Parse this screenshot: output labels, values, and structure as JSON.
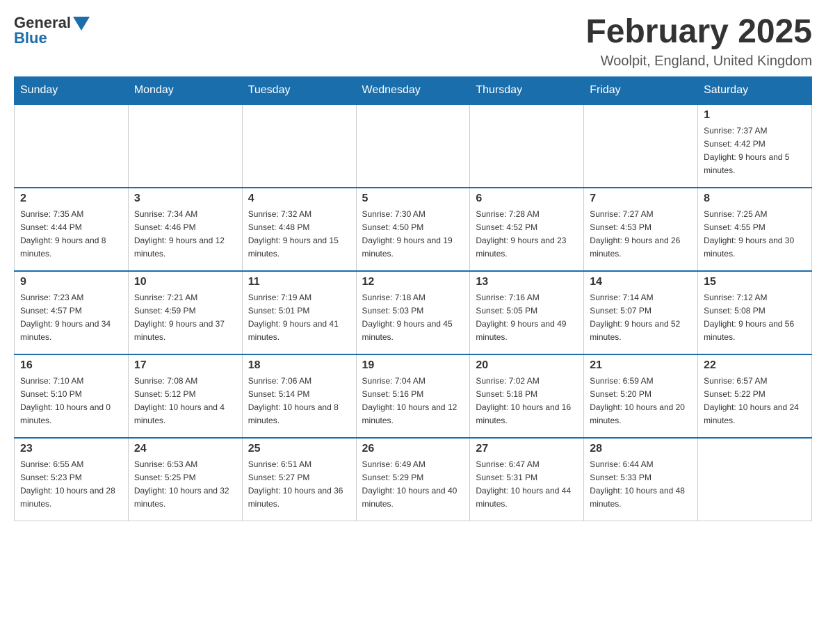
{
  "header": {
    "logo_general": "General",
    "logo_blue": "Blue",
    "month_title": "February 2025",
    "location": "Woolpit, England, United Kingdom"
  },
  "days_of_week": [
    "Sunday",
    "Monday",
    "Tuesday",
    "Wednesday",
    "Thursday",
    "Friday",
    "Saturday"
  ],
  "weeks": [
    [
      {
        "day": "",
        "info": ""
      },
      {
        "day": "",
        "info": ""
      },
      {
        "day": "",
        "info": ""
      },
      {
        "day": "",
        "info": ""
      },
      {
        "day": "",
        "info": ""
      },
      {
        "day": "",
        "info": ""
      },
      {
        "day": "1",
        "info": "Sunrise: 7:37 AM\nSunset: 4:42 PM\nDaylight: 9 hours and 5 minutes."
      }
    ],
    [
      {
        "day": "2",
        "info": "Sunrise: 7:35 AM\nSunset: 4:44 PM\nDaylight: 9 hours and 8 minutes."
      },
      {
        "day": "3",
        "info": "Sunrise: 7:34 AM\nSunset: 4:46 PM\nDaylight: 9 hours and 12 minutes."
      },
      {
        "day": "4",
        "info": "Sunrise: 7:32 AM\nSunset: 4:48 PM\nDaylight: 9 hours and 15 minutes."
      },
      {
        "day": "5",
        "info": "Sunrise: 7:30 AM\nSunset: 4:50 PM\nDaylight: 9 hours and 19 minutes."
      },
      {
        "day": "6",
        "info": "Sunrise: 7:28 AM\nSunset: 4:52 PM\nDaylight: 9 hours and 23 minutes."
      },
      {
        "day": "7",
        "info": "Sunrise: 7:27 AM\nSunset: 4:53 PM\nDaylight: 9 hours and 26 minutes."
      },
      {
        "day": "8",
        "info": "Sunrise: 7:25 AM\nSunset: 4:55 PM\nDaylight: 9 hours and 30 minutes."
      }
    ],
    [
      {
        "day": "9",
        "info": "Sunrise: 7:23 AM\nSunset: 4:57 PM\nDaylight: 9 hours and 34 minutes."
      },
      {
        "day": "10",
        "info": "Sunrise: 7:21 AM\nSunset: 4:59 PM\nDaylight: 9 hours and 37 minutes."
      },
      {
        "day": "11",
        "info": "Sunrise: 7:19 AM\nSunset: 5:01 PM\nDaylight: 9 hours and 41 minutes."
      },
      {
        "day": "12",
        "info": "Sunrise: 7:18 AM\nSunset: 5:03 PM\nDaylight: 9 hours and 45 minutes."
      },
      {
        "day": "13",
        "info": "Sunrise: 7:16 AM\nSunset: 5:05 PM\nDaylight: 9 hours and 49 minutes."
      },
      {
        "day": "14",
        "info": "Sunrise: 7:14 AM\nSunset: 5:07 PM\nDaylight: 9 hours and 52 minutes."
      },
      {
        "day": "15",
        "info": "Sunrise: 7:12 AM\nSunset: 5:08 PM\nDaylight: 9 hours and 56 minutes."
      }
    ],
    [
      {
        "day": "16",
        "info": "Sunrise: 7:10 AM\nSunset: 5:10 PM\nDaylight: 10 hours and 0 minutes."
      },
      {
        "day": "17",
        "info": "Sunrise: 7:08 AM\nSunset: 5:12 PM\nDaylight: 10 hours and 4 minutes."
      },
      {
        "day": "18",
        "info": "Sunrise: 7:06 AM\nSunset: 5:14 PM\nDaylight: 10 hours and 8 minutes."
      },
      {
        "day": "19",
        "info": "Sunrise: 7:04 AM\nSunset: 5:16 PM\nDaylight: 10 hours and 12 minutes."
      },
      {
        "day": "20",
        "info": "Sunrise: 7:02 AM\nSunset: 5:18 PM\nDaylight: 10 hours and 16 minutes."
      },
      {
        "day": "21",
        "info": "Sunrise: 6:59 AM\nSunset: 5:20 PM\nDaylight: 10 hours and 20 minutes."
      },
      {
        "day": "22",
        "info": "Sunrise: 6:57 AM\nSunset: 5:22 PM\nDaylight: 10 hours and 24 minutes."
      }
    ],
    [
      {
        "day": "23",
        "info": "Sunrise: 6:55 AM\nSunset: 5:23 PM\nDaylight: 10 hours and 28 minutes."
      },
      {
        "day": "24",
        "info": "Sunrise: 6:53 AM\nSunset: 5:25 PM\nDaylight: 10 hours and 32 minutes."
      },
      {
        "day": "25",
        "info": "Sunrise: 6:51 AM\nSunset: 5:27 PM\nDaylight: 10 hours and 36 minutes."
      },
      {
        "day": "26",
        "info": "Sunrise: 6:49 AM\nSunset: 5:29 PM\nDaylight: 10 hours and 40 minutes."
      },
      {
        "day": "27",
        "info": "Sunrise: 6:47 AM\nSunset: 5:31 PM\nDaylight: 10 hours and 44 minutes."
      },
      {
        "day": "28",
        "info": "Sunrise: 6:44 AM\nSunset: 5:33 PM\nDaylight: 10 hours and 48 minutes."
      },
      {
        "day": "",
        "info": ""
      }
    ]
  ]
}
